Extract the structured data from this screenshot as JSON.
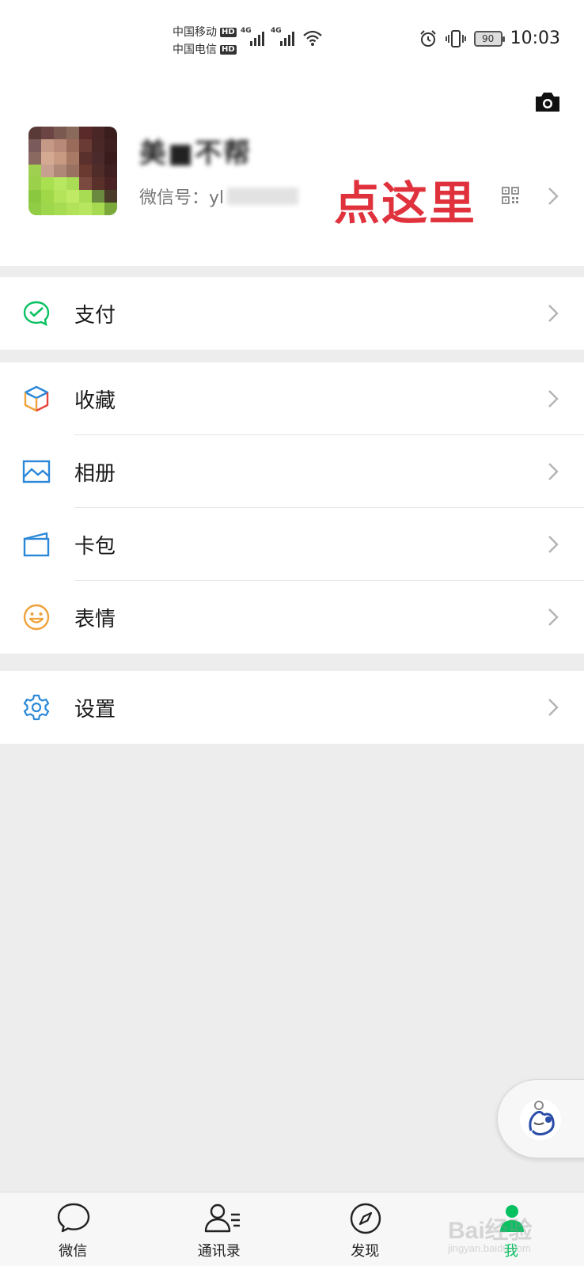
{
  "status_bar": {
    "carrier_1": "中国移动",
    "carrier_2": "中国电信",
    "hd": "HD",
    "network": "4G",
    "battery": "90",
    "time": "10:03"
  },
  "profile": {
    "nickname": "美■不帮",
    "wechat_id_label": "微信号：yl",
    "annotation": "点这里"
  },
  "menu": {
    "pay": "支付",
    "favorites": "收藏",
    "album": "相册",
    "cards": "卡包",
    "stickers": "表情",
    "settings": "设置"
  },
  "tabbar": {
    "chats": "微信",
    "contacts": "通讯录",
    "discover": "发现",
    "me": "我"
  },
  "watermark": {
    "brand": "Bai经验",
    "url": "jingyan.baidu.com"
  },
  "colors": {
    "accent": "#07c160",
    "annotation": "#e0323c",
    "icon_blue": "#2b88d8",
    "icon_orange": "#f0a23b"
  }
}
